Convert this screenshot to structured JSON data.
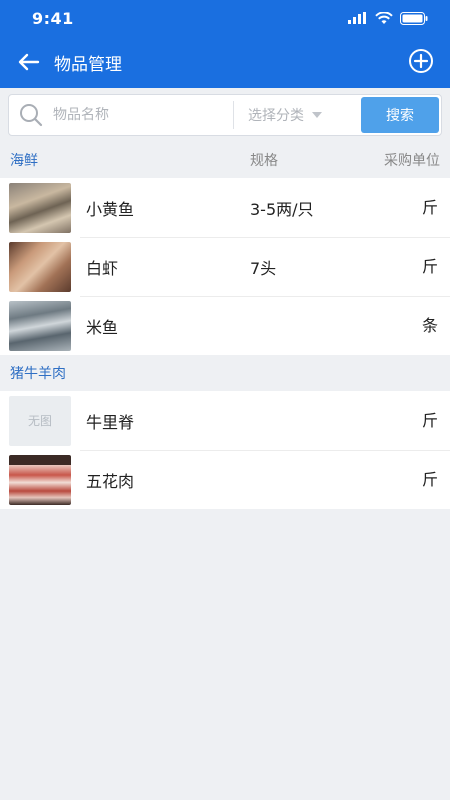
{
  "status": {
    "time": "9:41"
  },
  "header": {
    "title": "物品管理"
  },
  "search": {
    "placeholder": "物品名称",
    "category_placeholder": "选择分类",
    "button_label": "搜索"
  },
  "sections": [
    {
      "name": "海鲜",
      "spec_header": "规格",
      "unit_header": "采购单位",
      "items": [
        {
          "name": "小黄鱼",
          "spec": "3-5两/只",
          "unit": "斤",
          "image": "photo-fish"
        },
        {
          "name": "白虾",
          "spec": "7头",
          "unit": "斤",
          "image": "photo-shrimp"
        },
        {
          "name": "米鱼",
          "spec": "",
          "unit": "条",
          "image": "photo-fish"
        }
      ]
    },
    {
      "name": "猪牛羊肉",
      "items": [
        {
          "name": "牛里脊",
          "spec": "",
          "unit": "斤",
          "image_placeholder": "无图"
        },
        {
          "name": "五花肉",
          "spec": "",
          "unit": "斤",
          "image": "photo-pork"
        }
      ]
    }
  ],
  "colors": {
    "primary": "#1a6fe0",
    "search_button": "#4fa1ea",
    "section_title": "#2f6fc4"
  }
}
